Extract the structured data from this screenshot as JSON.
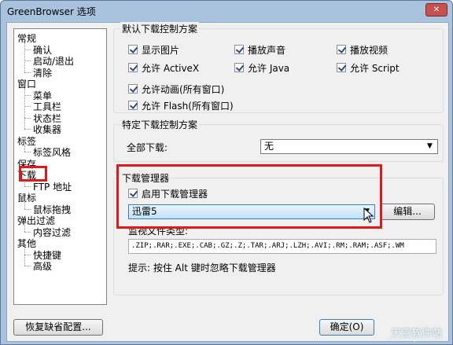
{
  "window": {
    "title": "GreenBrowser 选项",
    "close_symbol": "✕"
  },
  "tree": {
    "items": [
      {
        "label": "常规",
        "level": 0
      },
      {
        "label": "确认",
        "level": 1
      },
      {
        "label": "启动/退出",
        "level": 1
      },
      {
        "label": "清除",
        "level": 1
      },
      {
        "label": "窗口",
        "level": 0
      },
      {
        "label": "菜单",
        "level": 1
      },
      {
        "label": "工具栏",
        "level": 1
      },
      {
        "label": "状态栏",
        "level": 1
      },
      {
        "label": "收集器",
        "level": 1
      },
      {
        "label": "标签",
        "level": 0
      },
      {
        "label": "标签风格",
        "level": 1
      },
      {
        "label": "保存",
        "level": 0
      },
      {
        "label": "下载",
        "level": 0,
        "selected": true
      },
      {
        "label": "FTP 地址",
        "level": 1
      },
      {
        "label": "鼠标",
        "level": 0
      },
      {
        "label": "鼠标拖拽",
        "level": 1
      },
      {
        "label": "弹出过滤",
        "level": 0
      },
      {
        "label": "内容过滤",
        "level": 1
      },
      {
        "label": "其他",
        "level": 0
      },
      {
        "label": "快捷键",
        "level": 1
      },
      {
        "label": "高级",
        "level": 1
      }
    ]
  },
  "default_download": {
    "title": "默认下载控制方案",
    "options": {
      "show_images": {
        "label": "显示图片",
        "checked": true
      },
      "play_sound": {
        "label": "播放声音",
        "checked": true
      },
      "play_video": {
        "label": "播放视频",
        "checked": true
      },
      "allow_activex": {
        "label": "允许 ActiveX",
        "checked": true
      },
      "allow_java": {
        "label": "允许 Java",
        "checked": true
      },
      "allow_script": {
        "label": "允许 Script",
        "checked": true
      },
      "allow_animation": {
        "label": "允许动画(所有窗口)",
        "checked": true
      },
      "allow_flash": {
        "label": "允许 Flash(所有窗口)",
        "checked": true
      }
    }
  },
  "specific_download": {
    "title": "特定下载控制方案",
    "all_downloads_label": "全部下载:",
    "all_downloads_value": "无"
  },
  "download_manager": {
    "title": "下载管理器",
    "enable_label": "启用下载管理器",
    "enable_checked": true,
    "manager_value": "迅雷5",
    "edit_button": "编辑...",
    "monitor_label": "监视文件类型:",
    "monitor_value": ".ZIP;.RAR;.EXE;.CAB;.GZ;.Z;.TAR;.ARJ;.LZH;.AVI;.RM;.RAM;.ASF;.WM",
    "hint": "提示: 按住 Alt 键时忽略下载管理器"
  },
  "footer": {
    "restore_defaults": "恢复缺省配置...",
    "ok": "确定(O)"
  },
  "watermark": {
    "text": "天空软件站",
    "url": "www.skycn.com"
  }
}
